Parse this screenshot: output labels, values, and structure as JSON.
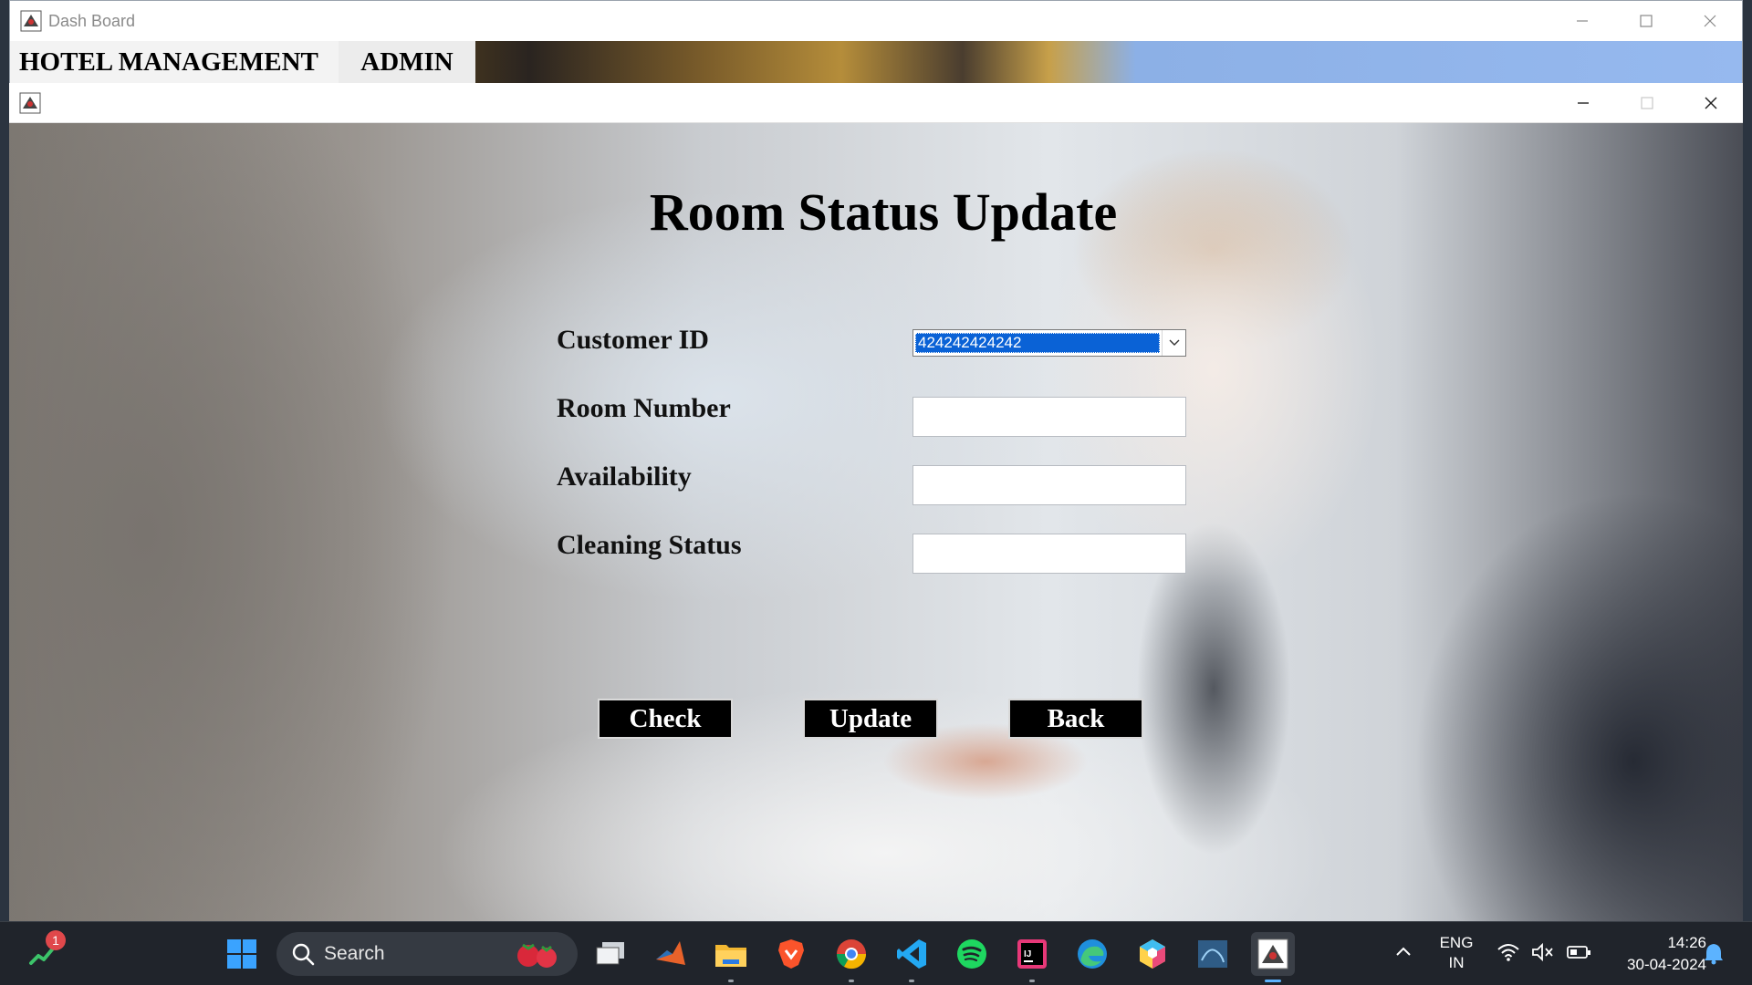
{
  "outer_window": {
    "title": "Dash Board",
    "menu": {
      "hotel": "HOTEL MANAGEMENT",
      "admin": "ADMIN"
    }
  },
  "inner_window": {
    "title": ""
  },
  "form": {
    "title": "Room Status Update",
    "labels": {
      "customer_id": "Customer ID",
      "room_number": "Room Number",
      "availability": "Availability",
      "cleaning_status": "Cleaning Status"
    },
    "values": {
      "customer_id": "424242424242",
      "room_number": "",
      "availability": "",
      "cleaning_status": ""
    },
    "buttons": {
      "check": "Check",
      "update": "Update",
      "back": "Back"
    }
  },
  "taskbar": {
    "search_label": "Search",
    "notification_count": "1",
    "language_line1": "ENG",
    "language_line2": "IN",
    "time": "14:26",
    "date": "30-04-2024",
    "pinned_apps": [
      "start-icon",
      "file-explorer-icon",
      "matlab-icon",
      "folder-icon",
      "brave-icon",
      "chrome-icon",
      "vscode-icon",
      "spotify-icon",
      "intellij-icon",
      "edge-icon",
      "cube-app-icon",
      "mysql-workbench-icon",
      "java-app-icon"
    ]
  },
  "colors": {
    "selection_blue": "#0a62d6",
    "button_black": "#000000",
    "taskbar": "#20242b"
  }
}
